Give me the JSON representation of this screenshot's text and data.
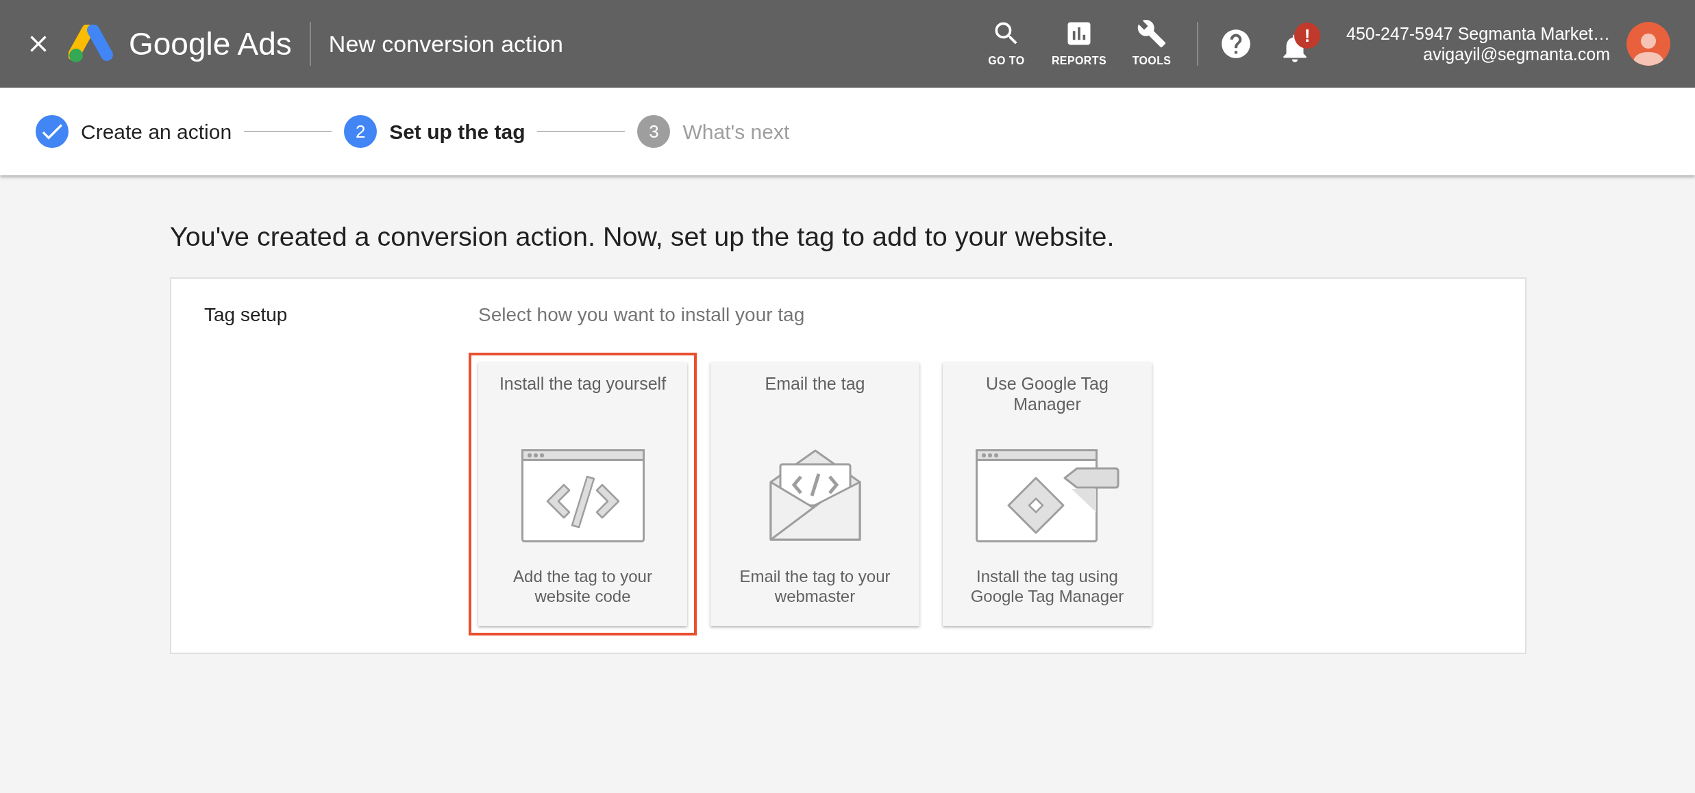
{
  "header": {
    "app_name": "Google Ads",
    "title": "New conversion action",
    "nav": [
      {
        "kind": "search",
        "label": "GO TO"
      },
      {
        "kind": "reports",
        "label": "REPORTS"
      },
      {
        "kind": "tools",
        "label": "TOOLS"
      }
    ],
    "notification_badge": "!",
    "account": {
      "name": "450-247-5947 Segmanta Market…",
      "email": "avigayil@segmanta.com"
    }
  },
  "stepper": [
    {
      "label": "Create an action",
      "done": true,
      "selected": false
    },
    {
      "number": "2",
      "label": "Set up the tag",
      "done": false,
      "selected": true
    },
    {
      "number": "3",
      "label": "What's next",
      "done": false,
      "selected": false
    }
  ],
  "headline": "You've created a conversion action. Now, set up the tag to add to your website.",
  "panel": {
    "label": "Tag setup",
    "prompt": "Select how you want to install your tag",
    "options": [
      {
        "kind": "code",
        "title": "Install the tag yourself",
        "description": "Add the tag to your website code",
        "selected": true
      },
      {
        "kind": "email",
        "title": "Email the tag",
        "description": "Email the tag to your webmaster",
        "selected": false
      },
      {
        "kind": "gtm",
        "title": "Use Google Tag Manager",
        "description": "Install the tag using Google Tag Manager",
        "selected": false
      }
    ]
  }
}
